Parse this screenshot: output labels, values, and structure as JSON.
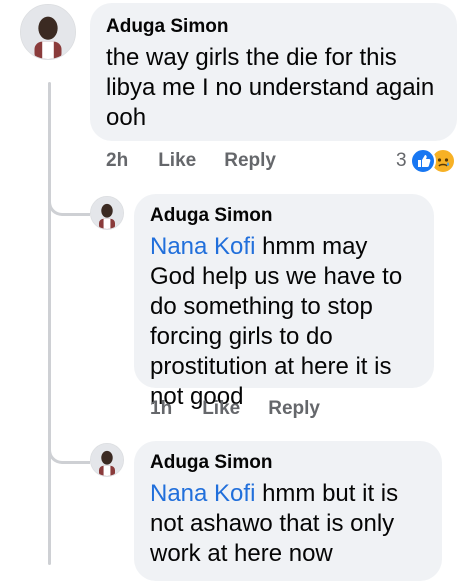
{
  "comments": [
    {
      "author": "Aduga Simon",
      "mention": "",
      "text": "the way girls the die for this libya me I no understand again ooh",
      "time": "2h",
      "like_label": "Like",
      "reply_label": "Reply",
      "reaction_count": "3",
      "reactions": [
        "like-icon",
        "sad-icon"
      ]
    },
    {
      "author": "Aduga Simon",
      "mention": "Nana Kofi",
      "text": " hmm may God help us we have to do something to stop forcing girls to do prostitution at here it is not good",
      "time": "1h",
      "like_label": "Like",
      "reply_label": "Reply"
    },
    {
      "author": "Aduga Simon",
      "mention": "Nana Kofi",
      "text": " hmm but it is not ashawo that is only work at here now"
    }
  ],
  "colors": {
    "bubble": "#f0f2f5",
    "mention": "#216fdb",
    "meta": "#65676b",
    "like_blue": "#1877f2",
    "sad_yellow": "#f7b125"
  }
}
